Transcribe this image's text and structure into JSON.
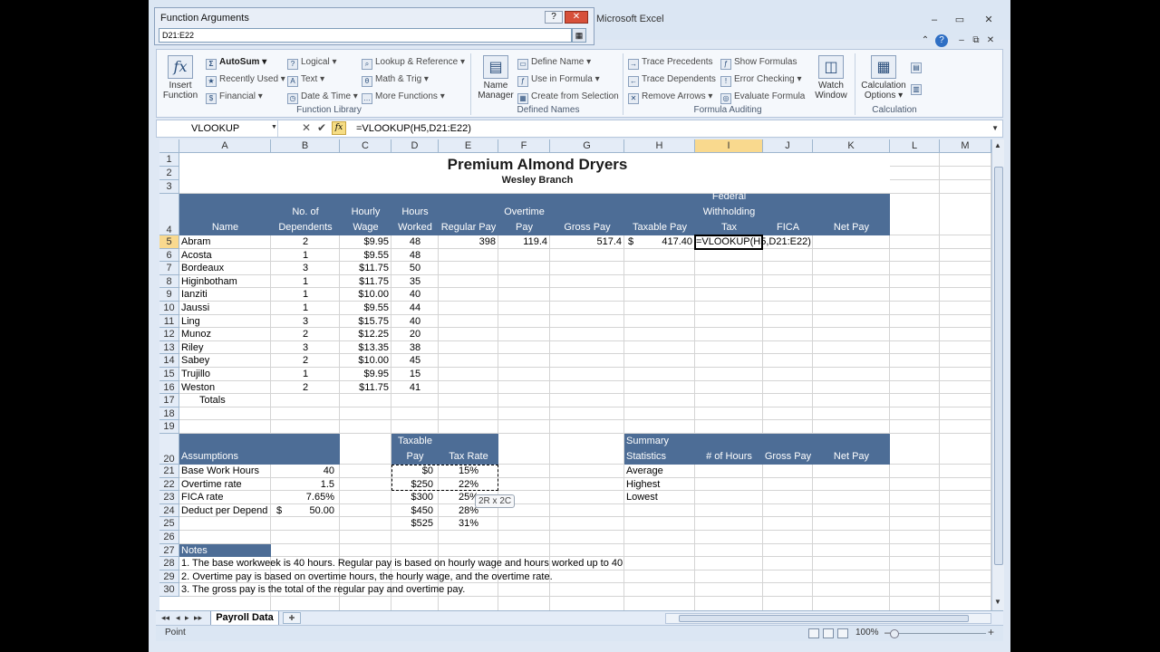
{
  "app": {
    "title": "Microsoft Excel",
    "minimize": "–",
    "restore": "▭",
    "close": "✕",
    "ribbon_min": "⌃",
    "help": "?",
    "wb_min": "–",
    "wb_restore": "⧉",
    "wb_close": "✕"
  },
  "dialog": {
    "title": "Function Arguments",
    "help": "?",
    "close": "✕",
    "input_value": "D21:E22",
    "collapse": "▦"
  },
  "ribbon": {
    "insert_function_line1": "Insert",
    "insert_function_line2": "Function",
    "autosum": "AutoSum",
    "recently_used": "Recently Used",
    "financial": "Financial",
    "logical": "Logical",
    "text": "Text",
    "date_time": "Date & Time",
    "lookup_reference": "Lookup & Reference",
    "math_trig": "Math & Trig",
    "more_functions": "More Functions",
    "function_library": "Function Library",
    "name_manager_line1": "Name",
    "name_manager_line2": "Manager",
    "define_name": "Define Name",
    "use_in_formula": "Use in Formula",
    "create_from_selection": "Create from Selection",
    "defined_names": "Defined Names",
    "trace_precedents": "Trace Precedents",
    "trace_dependents": "Trace Dependents",
    "remove_arrows": "Remove Arrows",
    "show_formulas": "Show Formulas",
    "error_checking": "Error Checking",
    "evaluate_formula": "Evaluate Formula",
    "formula_auditing": "Formula Auditing",
    "watch_window_line1": "Watch",
    "watch_window_line2": "Window",
    "calc_options_line1": "Calculation",
    "calc_options_line2": "Options",
    "calculation": "Calculation"
  },
  "formula_bar": {
    "name_box": "VLOOKUP",
    "formula": "=VLOOKUP(H5,D21:E22)",
    "cancel": "✕",
    "enter": "✔",
    "fx": "fx"
  },
  "grid": {
    "columns": [
      "A",
      "B",
      "C",
      "D",
      "E",
      "F",
      "G",
      "H",
      "I",
      "J",
      "K",
      "L",
      "M"
    ],
    "rows": [
      "1",
      "2",
      "3",
      "4",
      "5",
      "6",
      "7",
      "8",
      "9",
      "10",
      "11",
      "12",
      "13",
      "14",
      "15",
      "16",
      "17",
      "18",
      "19",
      "20",
      "21",
      "22",
      "23",
      "24",
      "25",
      "26",
      "27",
      "28",
      "29",
      "30"
    ]
  },
  "sheet": {
    "title": "Premium Almond Dryers",
    "subtitle": "Wesley Branch",
    "headers": {
      "name": "Name",
      "dependents_1": "No. of",
      "dependents_2": "Dependents",
      "wage_1": "Hourly",
      "wage_2": "Wage",
      "hours_1": "Hours",
      "hours_2": "Worked",
      "regular_pay": "Regular Pay",
      "overtime_1": "Overtime",
      "overtime_2": "Pay",
      "gross_pay": "Gross Pay",
      "taxable_pay": "Taxable Pay",
      "fed_1": "Federal",
      "fed_2": "Withholding",
      "fed_3": "Tax",
      "fica": "FICA",
      "net_pay": "Net Pay"
    },
    "employees": [
      {
        "name": "Abram",
        "dependents": "2",
        "wage": "$9.95",
        "hours": "48"
      },
      {
        "name": "Acosta",
        "dependents": "1",
        "wage": "$9.55",
        "hours": "48"
      },
      {
        "name": "Bordeaux",
        "dependents": "3",
        "wage": "$11.75",
        "hours": "50"
      },
      {
        "name": "Higinbotham",
        "dependents": "1",
        "wage": "$11.75",
        "hours": "35"
      },
      {
        "name": "Ianziti",
        "dependents": "1",
        "wage": "$10.00",
        "hours": "40"
      },
      {
        "name": "Jaussi",
        "dependents": "1",
        "wage": "$9.55",
        "hours": "44"
      },
      {
        "name": "Ling",
        "dependents": "3",
        "wage": "$15.75",
        "hours": "40"
      },
      {
        "name": "Munoz",
        "dependents": "2",
        "wage": "$12.25",
        "hours": "20"
      },
      {
        "name": "Riley",
        "dependents": "3",
        "wage": "$13.35",
        "hours": "38"
      },
      {
        "name": "Sabey",
        "dependents": "2",
        "wage": "$10.00",
        "hours": "45"
      },
      {
        "name": "Trujillo",
        "dependents": "1",
        "wage": "$9.95",
        "hours": "15"
      },
      {
        "name": "Weston",
        "dependents": "2",
        "wage": "$11.75",
        "hours": "41"
      }
    ],
    "abram_row": {
      "regular_pay": "398",
      "overtime_pay": "119.4",
      "gross_pay": "517.4",
      "taxable_symbol": "$",
      "taxable_value": "417.40",
      "editing_formula": "=VLOOKUP(H5,D21:E22)"
    },
    "totals_label": "Totals",
    "assumptions": {
      "header": "Assumptions",
      "rows": [
        {
          "label": "Base Work Hours",
          "symbol": "",
          "value": "40"
        },
        {
          "label": "Overtime rate",
          "symbol": "",
          "value": "1.5"
        },
        {
          "label": "FICA rate",
          "symbol": "",
          "value": "7.65%"
        },
        {
          "label": "Deduct per Depend",
          "symbol": "$",
          "value": "50.00"
        }
      ]
    },
    "tax_table": {
      "header_1": "Taxable",
      "header_2": "Pay",
      "header_rate": "Tax Rate",
      "rows": [
        {
          "pay": "$0",
          "rate": "15%"
        },
        {
          "pay": "$250",
          "rate": "22%"
        },
        {
          "pay": "$300",
          "rate": "25%"
        },
        {
          "pay": "$450",
          "rate": "28%"
        },
        {
          "pay": "$525",
          "rate": "31%"
        }
      ]
    },
    "range_tip": "2R x 2C",
    "summary": {
      "header_1": "Summary",
      "header_2": "Statistics",
      "hours": "# of Hours",
      "gross": "Gross Pay",
      "net": "Net Pay",
      "rows": [
        "Average",
        "Highest",
        "Lowest"
      ]
    },
    "notes": {
      "header": "Notes",
      "lines": [
        "1. The base workweek is 40 hours. Regular pay is based on hourly wage and hours worked up to 40",
        "2. Overtime pay is based on overtime hours, the hourly wage, and the overtime rate.",
        "3. The gross pay is the total of the regular pay and overtime pay."
      ]
    }
  },
  "tabs": {
    "active": "Payroll Data",
    "nav_first": "◂◂",
    "nav_prev": "◂",
    "nav_next": "▸",
    "nav_last": "▸▸"
  },
  "status": {
    "mode": "Point",
    "zoom": "100%",
    "zoom_minus": "–",
    "zoom_plus": "+"
  },
  "colors": {
    "header_fill": "#4d6d96",
    "selected_header": "#f9d98e"
  }
}
